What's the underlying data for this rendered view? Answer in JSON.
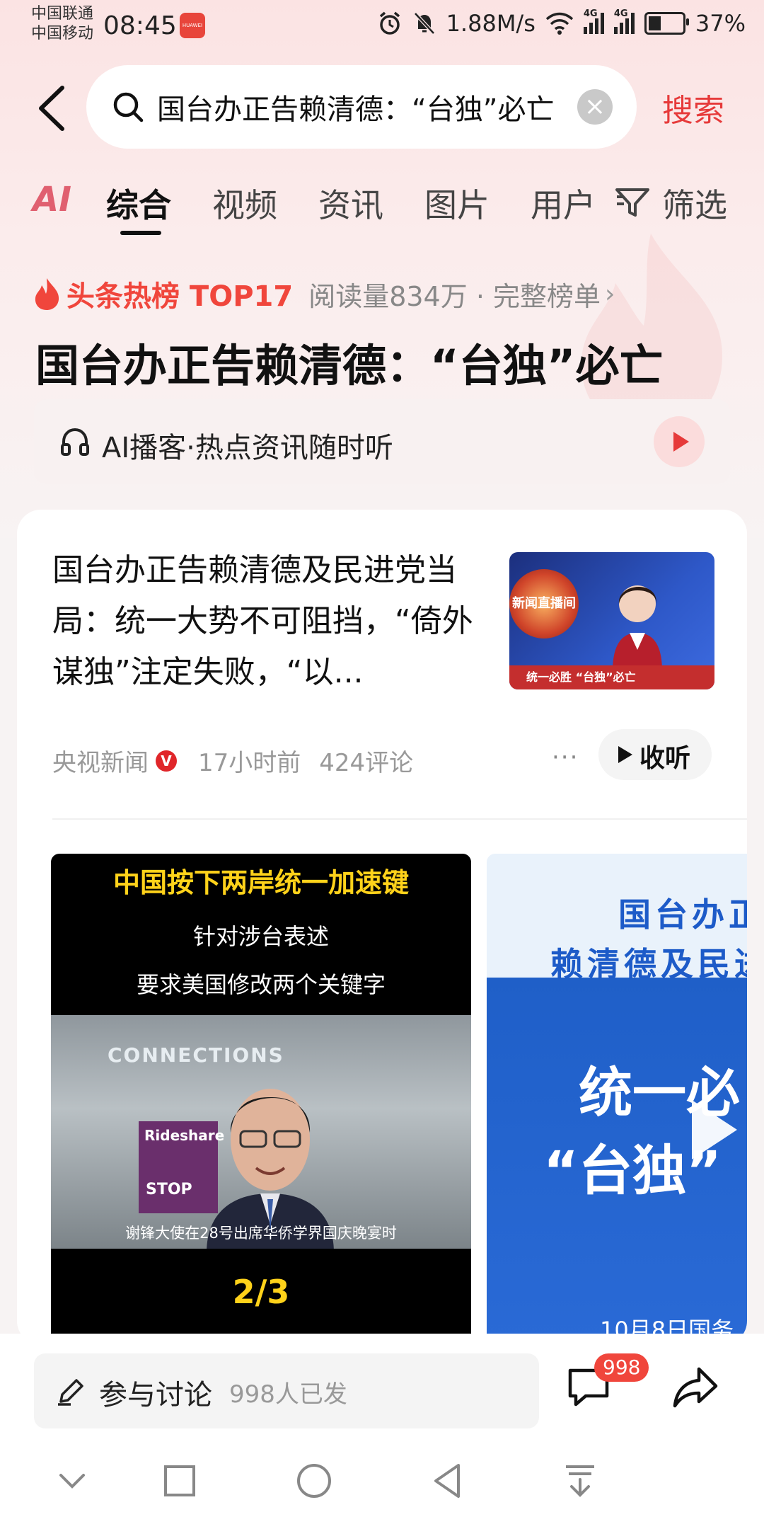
{
  "status_bar": {
    "carrier1": "中国联通",
    "carrier2": "中国移动",
    "time": "08:45",
    "speed": "1.88M/s",
    "net1": "4G",
    "net2": "4G",
    "battery": "37%",
    "battery_level": 0.37
  },
  "search": {
    "query": "国台办正告赖清德：“台独”必亡",
    "button": "搜索"
  },
  "tabs": [
    "AI",
    "综合",
    "视频",
    "资讯",
    "图片",
    "用户",
    "筛选"
  ],
  "active_tab": "综合",
  "hot": {
    "label": "头条热榜 TOP17",
    "meta": "阅读量834万 · 完整榜单",
    "arrow": "›",
    "headline": "国台办正告赖清德：“台独”必亡"
  },
  "podcast": {
    "label": "AI播客·热点资讯随时听"
  },
  "news": {
    "title": "国台办正告赖清德及民进党当局：统一大势不可阻挡，“倚外谋独”注定失败，“以...",
    "source": "央视新闻",
    "verified": "V",
    "time": "17小时前",
    "comments": "424评论",
    "more": "···",
    "listen": "收听",
    "thumb_logo": "新闻直播间",
    "thumb_ticker": "统一必胜 “台独”必亡"
  },
  "video1": {
    "title": "中国按下两岸统一加速键",
    "sub1": "针对涉台表述",
    "sub2": "要求美国修改两个关键字",
    "scene_sign": "CONNECTIONS",
    "scene_panel": "Rideshare",
    "scene_stop": "STOP",
    "caption": "谢锋大使在28号出席华侨学界国庆晚宴时",
    "page": "2/3"
  },
  "video2": {
    "line1": "国台办正",
    "line2": "赖清德及民进",
    "big1": "统一必",
    "big2": "“台独”",
    "date": "10月8日国务"
  },
  "bottom": {
    "discuss": "参与讨论",
    "discuss_count": "998人已发",
    "comment_badge": "998"
  },
  "colors": {
    "accent": "#e63a3a",
    "hot": "#f0463c",
    "video_title": "#ffd21a",
    "video2_blue": "#1f5fc8"
  }
}
